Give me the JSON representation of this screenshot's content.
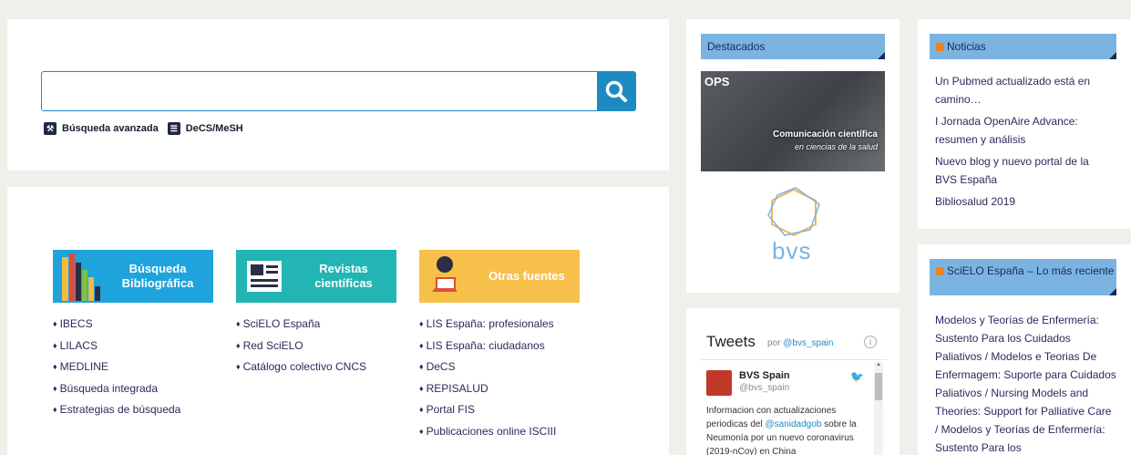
{
  "search": {
    "input_value": "",
    "advanced_label": "Búsqueda avanzada",
    "decs_label": "DeCS/MeSH"
  },
  "sources": {
    "tiles": [
      {
        "label": "Búsqueda Bibliográfica"
      },
      {
        "label": "Revistas científicas"
      },
      {
        "label": "Otras fuentes"
      }
    ],
    "col1": [
      "IBECS",
      "LILACS",
      "MEDLINE",
      "Búsqueda integrada",
      "Estrategias de búsqueda"
    ],
    "col2": [
      "SciELO España",
      "Red SciELO",
      "Catálogo colectivo CNCS"
    ],
    "col3": [
      "LIS España: profesionales",
      "LIS España: ciudadanos",
      "DeCS",
      "REPISALUD",
      "Portal FIS",
      "Publicaciones online ISCIII"
    ]
  },
  "destacados": {
    "title": "Destacados",
    "promo_ops": "OPS",
    "promo_caption1": "Comunicación científica",
    "promo_caption2": "en ciencias de la salud",
    "logo_text": "bvs"
  },
  "tweets": {
    "title": "Tweets",
    "by": "por",
    "account": "@bvs_spain",
    "name": "BVS Spain",
    "handle": "@bvs_spain",
    "text_pre": "Informacion con actualizaciones periodicas del",
    "mention": "@sanidadgob",
    "text_post": "sobre la Neumonía por un nuevo coronavirus (2019-nCoy) en China"
  },
  "noticias": {
    "title": "Noticias",
    "items": [
      "Un Pubmed actualizado está en camino…",
      "I Jornada OpenAire Advance: resumen y análisis",
      "Nuevo blog y nuevo portal de la BVS España",
      "Bibliosalud 2019"
    ]
  },
  "scielo": {
    "title": "SciELO España – Lo más reciente",
    "text": "Modelos y Teorías de Enfermería: Sustento Para los Cuidados Paliativos / Modelos e Teorias De Enfermagem: Suporte para Cuidados Paliativos / Nursing Models and Theories: Support for Palliative Care / Modelos y Teorías de Enfermería: Sustento Para los"
  }
}
